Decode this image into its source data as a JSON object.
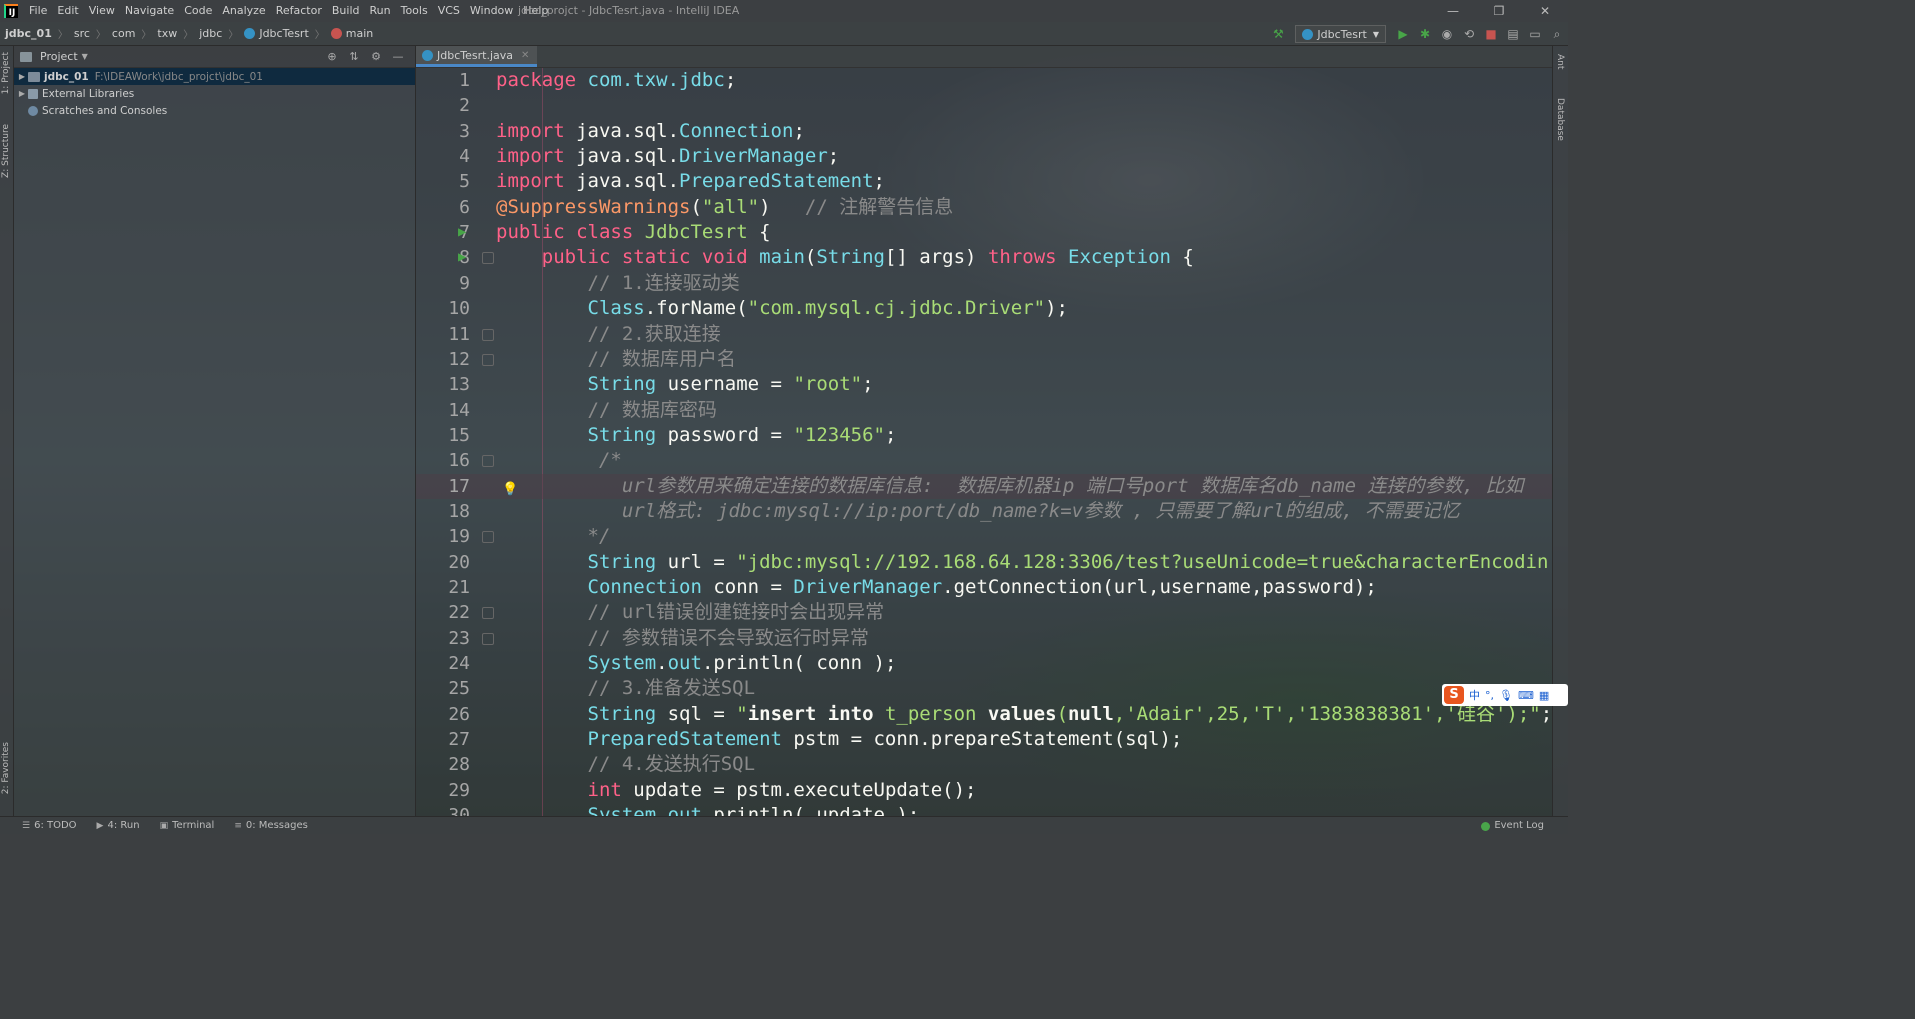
{
  "window": {
    "title": "jdbc_projct - JdbcTesrt.java - IntelliJ IDEA",
    "controls": [
      "—",
      "❐",
      "✕"
    ]
  },
  "menu": [
    "File",
    "Edit",
    "View",
    "Navigate",
    "Code",
    "Analyze",
    "Refactor",
    "Build",
    "Run",
    "Tools",
    "VCS",
    "Window",
    "Help"
  ],
  "breadcrumb": [
    "jdbc_01",
    "src",
    "com",
    "txw",
    "jdbc",
    "JdbcTesrt",
    "main"
  ],
  "toolbar": {
    "run_config": "JdbcTesrt"
  },
  "left_stripe": {
    "project_label": "1: Project",
    "structure_label": "Z: Structure",
    "favorites_label": "2: Favorites"
  },
  "right_stripe": {
    "ant_label": "Ant",
    "database_label": "Database"
  },
  "project_panel": {
    "title": "Project",
    "items": [
      {
        "label": "jdbc_01",
        "path": "F:\\IDEAWork\\jdbc_projct\\jdbc_01",
        "selected": true
      },
      {
        "label": "External Libraries"
      },
      {
        "label": "Scratches and Consoles"
      }
    ]
  },
  "editor": {
    "tab": "JdbcTesrt.java",
    "highlighted_line": 17,
    "lines": [
      "package com.txw.jdbc;",
      "",
      "import java.sql.Connection;",
      "import java.sql.DriverManager;",
      "import java.sql.PreparedStatement;",
      "@SuppressWarnings(\"all\")   // 注解警告信息",
      "public class JdbcTesrt {",
      "    public static void main(String[] args) throws Exception {",
      "        // 1.连接驱动类",
      "        Class.forName(\"com.mysql.cj.jdbc.Driver\");",
      "        // 2.获取连接",
      "        // 数据库用户名",
      "        String username = \"root\";",
      "        // 数据库密码",
      "        String password = \"123456\";",
      "         /*",
      "           url参数用来确定连接的数据库信息:  数据库机器ip 端口号port 数据库名db_name 连接的参数, 比如",
      "           url格式: jdbc:mysql://ip:port/db_name?k=v参数 , 只需要了解url的组成, 不需要记忆",
      "        */",
      "        String url = \"jdbc:mysql://192.168.64.128:3306/test?useUnicode=true&characterEncodin",
      "        Connection conn = DriverManager.getConnection(url,username,password);",
      "        // url错误创建链接时会出现异常",
      "        // 参数错误不会导致运行时异常",
      "        System.out.println( conn );",
      "        // 3.准备发送SQL",
      "        String sql = \"insert into t_person values(null,'Adair',25,'T','1383838381','硅谷');\";",
      "        PreparedStatement pstm = conn.prepareStatement(sql);",
      "        // 4.发送执行SQL",
      "        int update = pstm.executeUpdate();",
      "        System.out.println( update );"
    ]
  },
  "ime": {
    "logo": "S",
    "mode": "中",
    "punct": "°,"
  },
  "status_bar": {
    "items": [
      {
        "num": "6",
        "label": "6: TODO"
      },
      {
        "num": "4",
        "label": "4: Run"
      },
      {
        "label": "Terminal"
      },
      {
        "num": "0",
        "label": "0: Messages"
      }
    ],
    "event_log": "Event Log"
  }
}
